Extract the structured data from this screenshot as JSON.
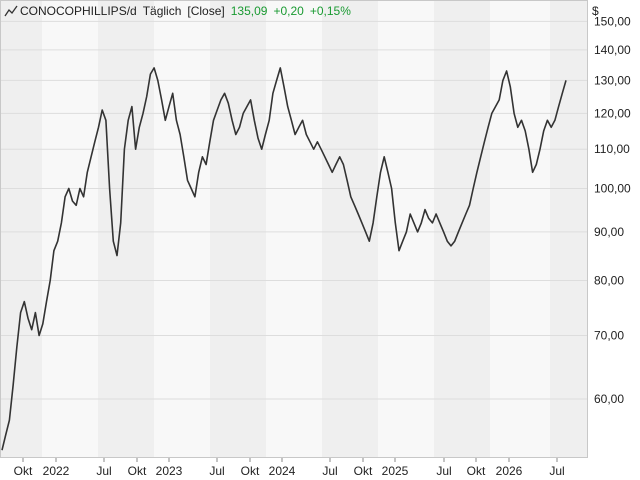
{
  "header": {
    "symbol": "CONOCOPHILLIPS/d",
    "interval": "Täglich",
    "price_type": "[Close]",
    "last": "135,09",
    "change": "+0,20",
    "change_pct": "+0,15%",
    "change_color": "#1a9a32",
    "symbol_icon": "line-chart-icon"
  },
  "chart_data": {
    "type": "line",
    "y_scale": "log",
    "ylim": [
      52,
      158
    ],
    "currency_label": "$",
    "y_ticks": [
      150,
      140,
      130,
      120,
      110,
      100,
      90,
      80,
      70,
      60
    ],
    "y_tick_labels": [
      "150,00",
      "140,00",
      "130,00",
      "120,00",
      "110,00",
      "100,00",
      "90,00",
      "80,00",
      "70,00",
      "60,00"
    ],
    "x_ticks": [
      "Okt",
      "2022",
      "Jul",
      "Okt",
      "2023",
      "Jul",
      "Okt",
      "2024",
      "Jul",
      "Okt",
      "2025",
      "Jul",
      "Okt",
      "2026",
      "Jul"
    ],
    "grid": true,
    "line_color": "#333333",
    "series": [
      {
        "values": [
          53,
          55,
          57,
          62,
          68,
          74,
          76,
          73,
          71,
          74,
          70,
          72,
          76,
          80,
          86,
          88,
          92,
          98,
          100,
          97,
          96,
          100,
          98,
          104,
          108,
          112,
          116,
          121,
          118,
          100,
          88,
          85,
          92,
          110,
          118,
          122,
          110,
          116,
          120,
          125,
          132,
          134,
          130,
          124,
          118,
          122,
          126,
          118,
          114,
          108,
          102,
          100,
          98,
          104,
          108,
          106,
          112,
          118,
          121,
          124,
          126,
          123,
          118,
          114,
          116,
          120,
          122,
          124,
          118,
          113,
          110,
          114,
          118,
          126,
          130,
          134,
          128,
          122,
          118,
          114,
          116,
          118,
          114,
          112,
          110,
          112,
          110,
          108,
          106,
          104,
          106,
          108,
          106,
          102,
          98,
          96,
          94,
          92,
          90,
          88,
          92,
          98,
          104,
          108,
          104,
          100,
          92,
          86,
          88,
          90,
          94,
          92,
          90,
          92,
          95,
          93,
          92,
          94,
          92,
          90,
          88,
          87,
          88,
          90,
          92,
          94,
          96,
          100,
          104,
          108,
          112,
          116,
          120,
          122,
          124,
          130,
          133,
          128,
          120,
          116,
          118,
          115,
          110,
          104,
          106,
          110,
          115,
          118,
          116,
          118,
          122,
          126,
          130
        ]
      }
    ]
  }
}
